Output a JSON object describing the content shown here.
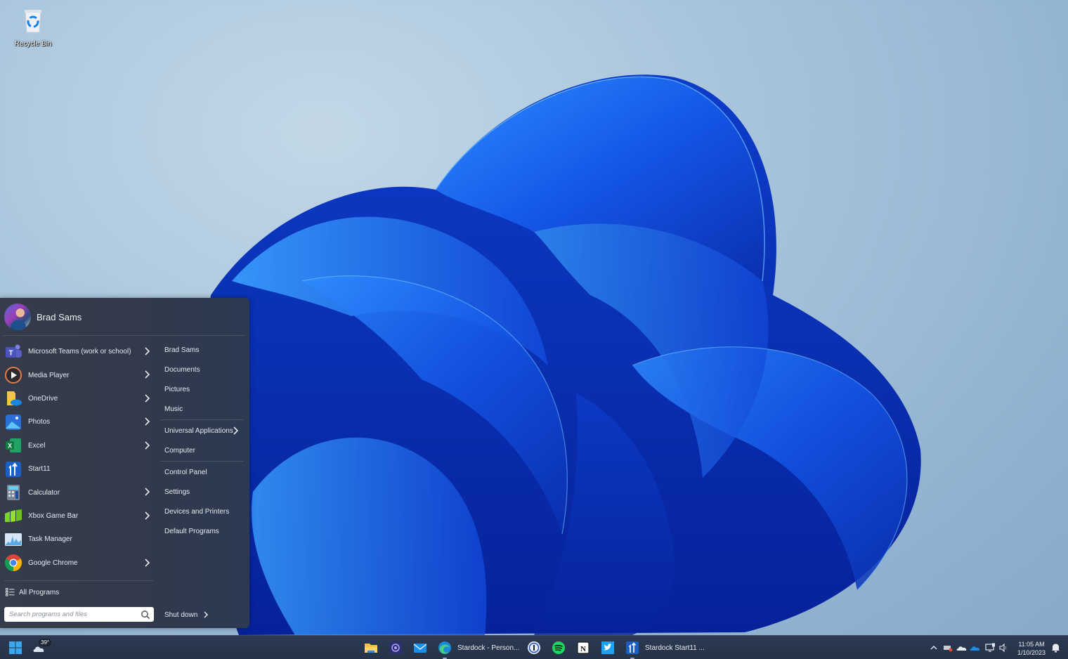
{
  "desktop": {
    "icons": [
      {
        "label": "Recycle Bin",
        "icon": "recycle-bin-icon"
      }
    ]
  },
  "start_menu": {
    "user": {
      "name": "Brad Sams",
      "icon": "user-avatar"
    },
    "pinned_apps": [
      {
        "label": "Microsoft Teams (work or school)",
        "icon": "teams-icon",
        "has_submenu": true
      },
      {
        "label": "Media Player",
        "icon": "media-player-icon",
        "has_submenu": true
      },
      {
        "label": "OneDrive",
        "icon": "onedrive-icon",
        "has_submenu": true
      },
      {
        "label": "Photos",
        "icon": "photos-icon",
        "has_submenu": true
      },
      {
        "label": "Excel",
        "icon": "excel-icon",
        "has_submenu": true
      },
      {
        "label": "Start11",
        "icon": "start11-icon",
        "has_submenu": false
      },
      {
        "label": "Calculator",
        "icon": "calculator-icon",
        "has_submenu": true
      },
      {
        "label": "Xbox Game Bar",
        "icon": "xbox-game-bar-icon",
        "has_submenu": true
      },
      {
        "label": "Task Manager",
        "icon": "task-manager-icon",
        "has_submenu": false
      },
      {
        "label": "Google Chrome",
        "icon": "chrome-icon",
        "has_submenu": true
      }
    ],
    "places": [
      {
        "label": "Brad Sams"
      },
      {
        "label": "Documents"
      },
      {
        "label": "Pictures"
      },
      {
        "label": "Music"
      },
      {
        "label": "Universal Applications",
        "has_submenu": true
      },
      {
        "label": "Computer"
      },
      {
        "label": "Control Panel"
      },
      {
        "label": "Settings"
      },
      {
        "label": "Devices and Printers"
      },
      {
        "label": "Default Programs"
      }
    ],
    "all_programs_label": "All Programs",
    "search": {
      "placeholder": "Search programs and files",
      "value": ""
    },
    "shutdown_label": "Shut down"
  },
  "taskbar": {
    "start_icon": "windows-start-icon",
    "weather": {
      "temperature": "39°",
      "icon": "weather-cloud-icon"
    },
    "apps": [
      {
        "icon": "file-explorer-icon",
        "label": ""
      },
      {
        "icon": "screen-capture-icon",
        "label": ""
      },
      {
        "icon": "mail-icon",
        "label": ""
      },
      {
        "icon": "edge-icon",
        "label": "Stardock - Person..."
      },
      {
        "icon": "1password-icon",
        "label": ""
      },
      {
        "icon": "spotify-icon",
        "label": ""
      },
      {
        "icon": "notion-icon",
        "label": ""
      },
      {
        "icon": "twitter-icon",
        "label": ""
      },
      {
        "icon": "start11-icon",
        "label": "Stardock Start11 ..."
      }
    ],
    "tray": {
      "icons": [
        "chevron-up-icon",
        "network-drive-icon",
        "onedrive-personal-icon",
        "onedrive-business-icon",
        "display-icon",
        "volume-icon"
      ],
      "time": "11:05 AM",
      "date": "1/10/2023",
      "notification_icon": "notification-icon"
    }
  },
  "colors": {
    "menu_bg": "#343b4b",
    "taskbar_bg": "#2a384f",
    "accent_blue": "#1f6fff",
    "text": "#e6e9ef"
  }
}
